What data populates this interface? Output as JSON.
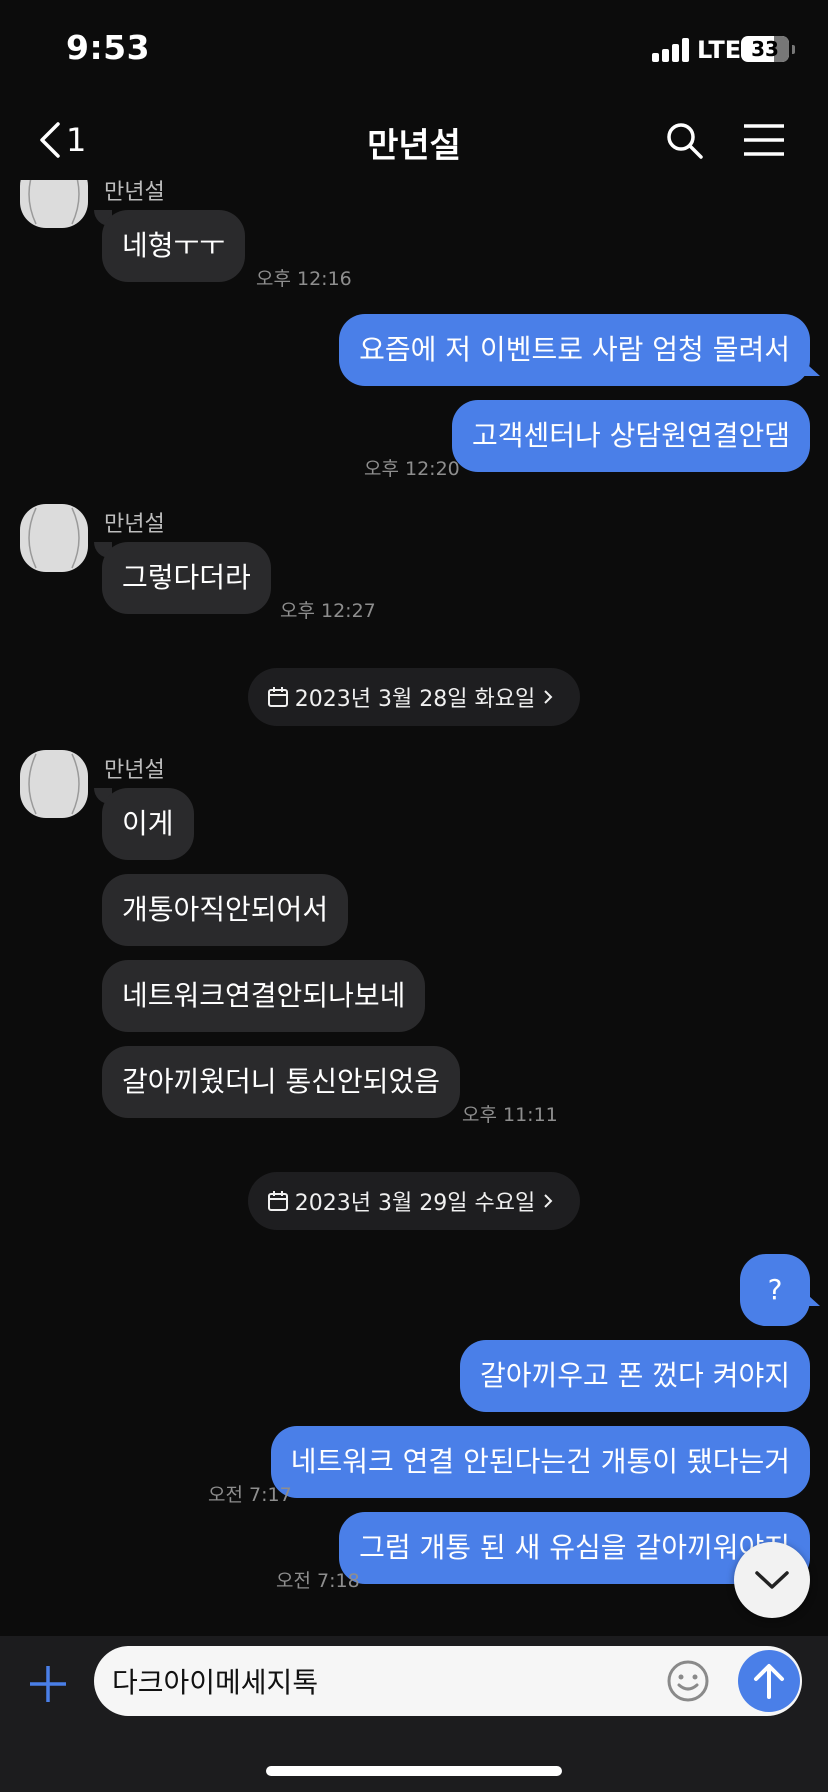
{
  "status_bar": {
    "time": "9:53",
    "network": "LTE",
    "battery": "33"
  },
  "header": {
    "back_count": "1",
    "title": "만년설"
  },
  "messages": [
    {
      "id": "m1",
      "sender": "만년설",
      "text": "네형ㅜㅜ",
      "time": "오후 12:16"
    },
    {
      "id": "m2",
      "text": "요즘에 저 이벤트로 사람 엄청 몰려서"
    },
    {
      "id": "m3",
      "text": "고객센터나 상담원연결안댐",
      "time": "오후 12:20"
    },
    {
      "id": "m4",
      "sender": "만년설",
      "text": "그렇다더라",
      "time": "오후 12:27"
    },
    {
      "id": "d1",
      "date": "2023년 3월 28일 화요일"
    },
    {
      "id": "m5",
      "sender": "만년설",
      "text": "이게"
    },
    {
      "id": "m6",
      "text": "개통아직안되어서"
    },
    {
      "id": "m7",
      "text": "네트워크연결안되나보네"
    },
    {
      "id": "m8",
      "text": "갈아끼웠더니 통신안되었음",
      "time": "오후 11:11"
    },
    {
      "id": "d2",
      "date": "2023년 3월 29일 수요일"
    },
    {
      "id": "m9",
      "text": "?"
    },
    {
      "id": "m10",
      "text": "갈아끼우고 폰 껐다 켜야지"
    },
    {
      "id": "m11",
      "text": "네트워크 연결 안된다는건 개통이 됐다는거",
      "time": "오전 7:17"
    },
    {
      "id": "m12",
      "text": "그럼 개통 된 새 유심을 갈아끼워야지",
      "time": "오전 7:18"
    }
  ],
  "input": {
    "value": "다크아이메세지톡"
  },
  "colors": {
    "background": "#0c0c0c",
    "outgoing_bubble": "#4a7fe8",
    "incoming_bubble": "#2a2a2c"
  },
  "icons": [
    "back-chevron-icon",
    "search-icon",
    "menu-icon",
    "calendar-icon",
    "chevron-right-icon",
    "chevron-down-icon",
    "plus-icon",
    "emoji-icon",
    "send-arrow-icon"
  ]
}
